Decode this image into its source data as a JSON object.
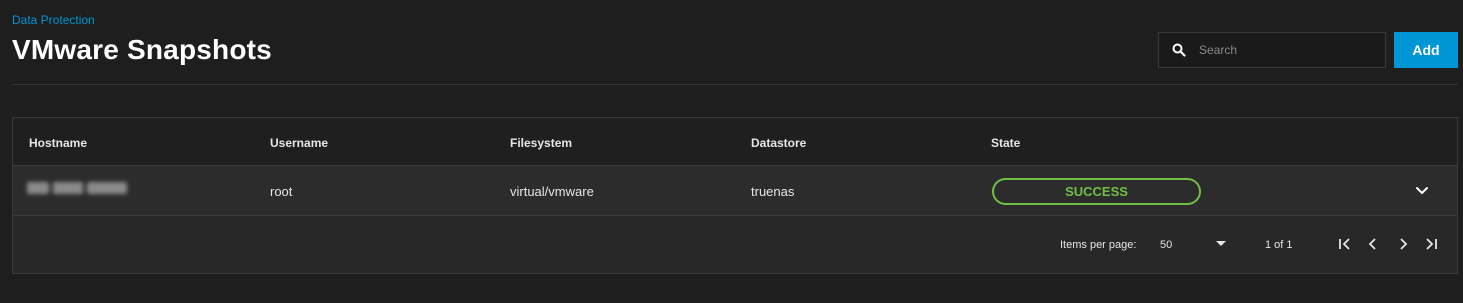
{
  "header": {
    "breadcrumb": "Data Protection",
    "title": "VMware Snapshots"
  },
  "search": {
    "placeholder": "Search",
    "value": "",
    "icon": "search-icon"
  },
  "toolbar": {
    "add_label": "Add"
  },
  "colors": {
    "accent": "#0095d5",
    "success": "#71bf44",
    "background": "#1e1e1e"
  },
  "table": {
    "columns": [
      "Hostname",
      "Username",
      "Filesystem",
      "Datastore",
      "State"
    ],
    "rows": [
      {
        "hostname": "",
        "username": "root",
        "filesystem": "virtual/vmware",
        "datastore": "truenas",
        "state": "SUCCESS"
      }
    ]
  },
  "paginator": {
    "items_per_page_label": "Items per page:",
    "items_per_page_value": "50",
    "range_label": "1 of 1"
  }
}
